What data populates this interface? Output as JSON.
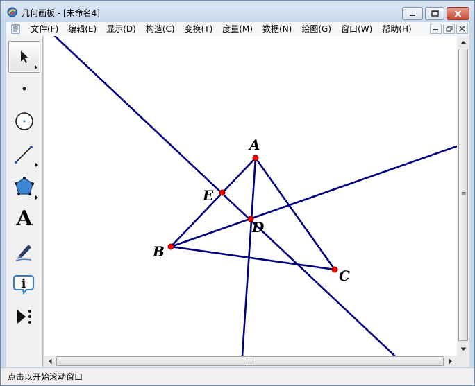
{
  "window": {
    "title": "几何画板 - [未命名4]"
  },
  "menu": {
    "items": [
      {
        "label": "文件(F)"
      },
      {
        "label": "编辑(E)"
      },
      {
        "label": "显示(D)"
      },
      {
        "label": "构造(C)"
      },
      {
        "label": "变换(T)"
      },
      {
        "label": "度量(M)"
      },
      {
        "label": "数据(N)"
      },
      {
        "label": "绘图(G)"
      },
      {
        "label": "窗口(W)"
      },
      {
        "label": "帮助(H)"
      }
    ]
  },
  "tools": [
    {
      "name": "arrow-tool",
      "icon": "arrow-icon",
      "active": true
    },
    {
      "name": "point-tool",
      "icon": "point-icon",
      "active": false
    },
    {
      "name": "compass-tool",
      "icon": "circle-icon",
      "active": false
    },
    {
      "name": "straightedge-tool",
      "icon": "line-icon",
      "active": false
    },
    {
      "name": "polygon-tool",
      "icon": "polygon-icon",
      "active": false
    },
    {
      "name": "text-tool",
      "icon": "text-a-icon",
      "label": "A",
      "active": false
    },
    {
      "name": "marker-tool",
      "icon": "marker-icon",
      "active": false
    },
    {
      "name": "information-tool",
      "icon": "info-icon",
      "label": "i",
      "active": false
    },
    {
      "name": "custom-tool",
      "icon": "custom-tool-icon",
      "active": false
    }
  ],
  "geometry": {
    "points": {
      "A": {
        "label": "A"
      },
      "B": {
        "label": "B"
      },
      "C": {
        "label": "C"
      },
      "D": {
        "label": "D"
      },
      "E": {
        "label": "E"
      }
    },
    "line_color": "#00007f",
    "point_color": "#ff0000"
  },
  "status": {
    "text": "点击以开始滚动窗口"
  },
  "colors": {
    "titlebar": "#c6d7ec",
    "close_button": "#c54a31"
  }
}
